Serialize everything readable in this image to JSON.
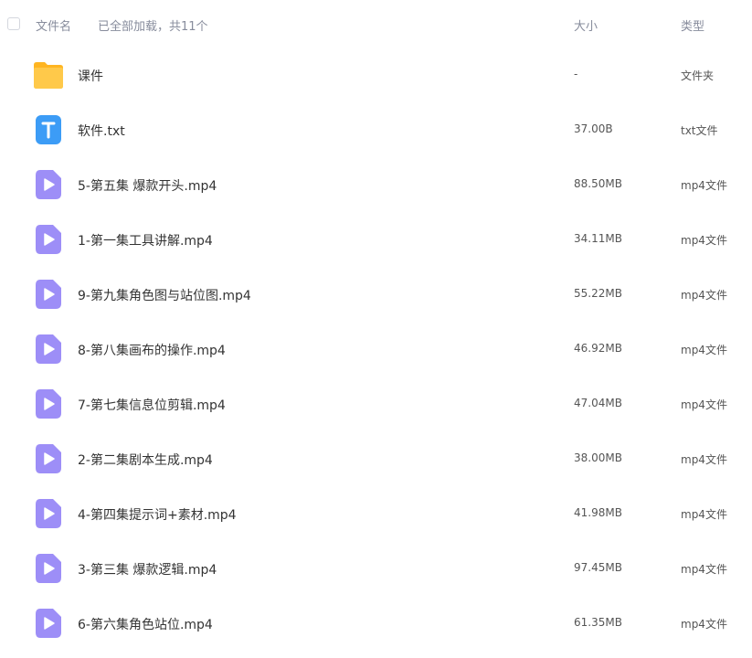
{
  "header": {
    "name_label": "文件名",
    "load_status": "已全部加载，共11个",
    "size_label": "大小",
    "type_label": "类型"
  },
  "colors": {
    "folder": "#ffc94a",
    "text_file": "#3c9cf6",
    "video": "#9d8ef7"
  },
  "files": [
    {
      "name": "课件",
      "size": "-",
      "type": "文件夹",
      "icon": "folder-icon"
    },
    {
      "name": "软件.txt",
      "size": "37.00B",
      "type": "txt文件",
      "icon": "text-file-icon"
    },
    {
      "name": "5-第五集 爆款开头.mp4",
      "size": "88.50MB",
      "type": "mp4文件",
      "icon": "video-file-icon"
    },
    {
      "name": "1-第一集工具讲解.mp4",
      "size": "34.11MB",
      "type": "mp4文件",
      "icon": "video-file-icon"
    },
    {
      "name": "9-第九集角色图与站位图.mp4",
      "size": "55.22MB",
      "type": "mp4文件",
      "icon": "video-file-icon"
    },
    {
      "name": "8-第八集画布的操作.mp4",
      "size": "46.92MB",
      "type": "mp4文件",
      "icon": "video-file-icon"
    },
    {
      "name": "7-第七集信息位剪辑.mp4",
      "size": "47.04MB",
      "type": "mp4文件",
      "icon": "video-file-icon"
    },
    {
      "name": "2-第二集剧本生成.mp4",
      "size": "38.00MB",
      "type": "mp4文件",
      "icon": "video-file-icon"
    },
    {
      "name": "4-第四集提示词+素材.mp4",
      "size": "41.98MB",
      "type": "mp4文件",
      "icon": "video-file-icon"
    },
    {
      "name": "3-第三集 爆款逻辑.mp4",
      "size": "97.45MB",
      "type": "mp4文件",
      "icon": "video-file-icon"
    },
    {
      "name": "6-第六集角色站位.mp4",
      "size": "61.35MB",
      "type": "mp4文件",
      "icon": "video-file-icon"
    }
  ]
}
